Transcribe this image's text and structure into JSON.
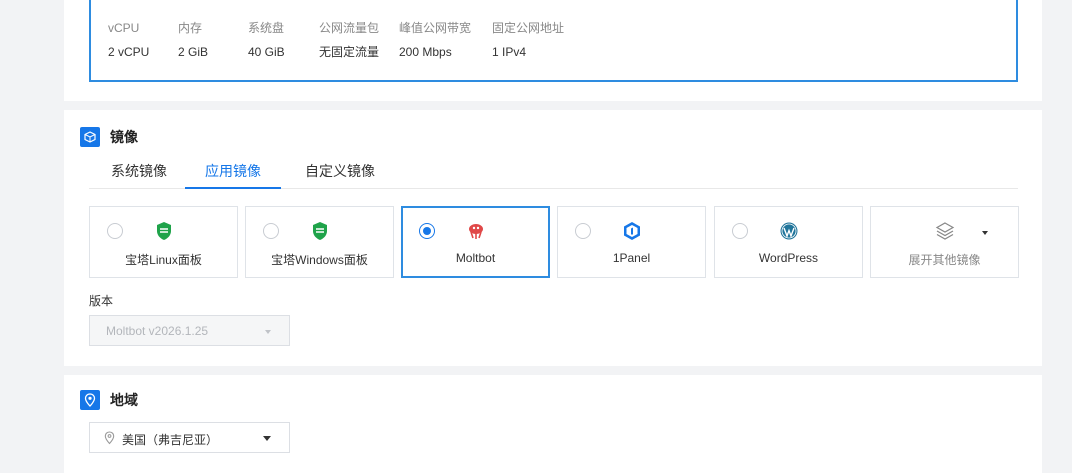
{
  "specs": [
    {
      "label": "vCPU",
      "value": "2 vCPU"
    },
    {
      "label": "内存",
      "value": "2 GiB"
    },
    {
      "label": "系统盘",
      "value": "40 GiB"
    },
    {
      "label": "公网流量包",
      "value": "无固定流量"
    },
    {
      "label": "峰值公网带宽",
      "value": "200 Mbps"
    },
    {
      "label": "固定公网地址",
      "value": "1 IPv4"
    }
  ],
  "image_section": {
    "title": "镜像",
    "tabs": [
      {
        "label": "系统镜像",
        "active": false
      },
      {
        "label": "应用镜像",
        "active": true
      },
      {
        "label": "自定义镜像",
        "active": false
      }
    ],
    "cards": [
      {
        "label": "宝塔Linux面板",
        "icon": "bt-shield-icon",
        "selected": false
      },
      {
        "label": "宝塔Windows面板",
        "icon": "bt-shield-icon",
        "selected": false
      },
      {
        "label": "Moltbot",
        "icon": "moltbot-icon",
        "selected": true
      },
      {
        "label": "1Panel",
        "icon": "1panel-icon",
        "selected": false
      },
      {
        "label": "WordPress",
        "icon": "wordpress-icon",
        "selected": false
      },
      {
        "label": "展开其他镜像",
        "icon": "layers-icon",
        "selected": false
      }
    ],
    "version_label": "版本",
    "version_value": "Moltbot v2026.1.25"
  },
  "region_section": {
    "title": "地域",
    "value": "美国（弗吉尼亚）"
  },
  "colors": {
    "accent": "#1677e8",
    "selected_border": "#2e8ce0",
    "bt_green": "#1fa34a",
    "molt_red": "#e04848"
  }
}
